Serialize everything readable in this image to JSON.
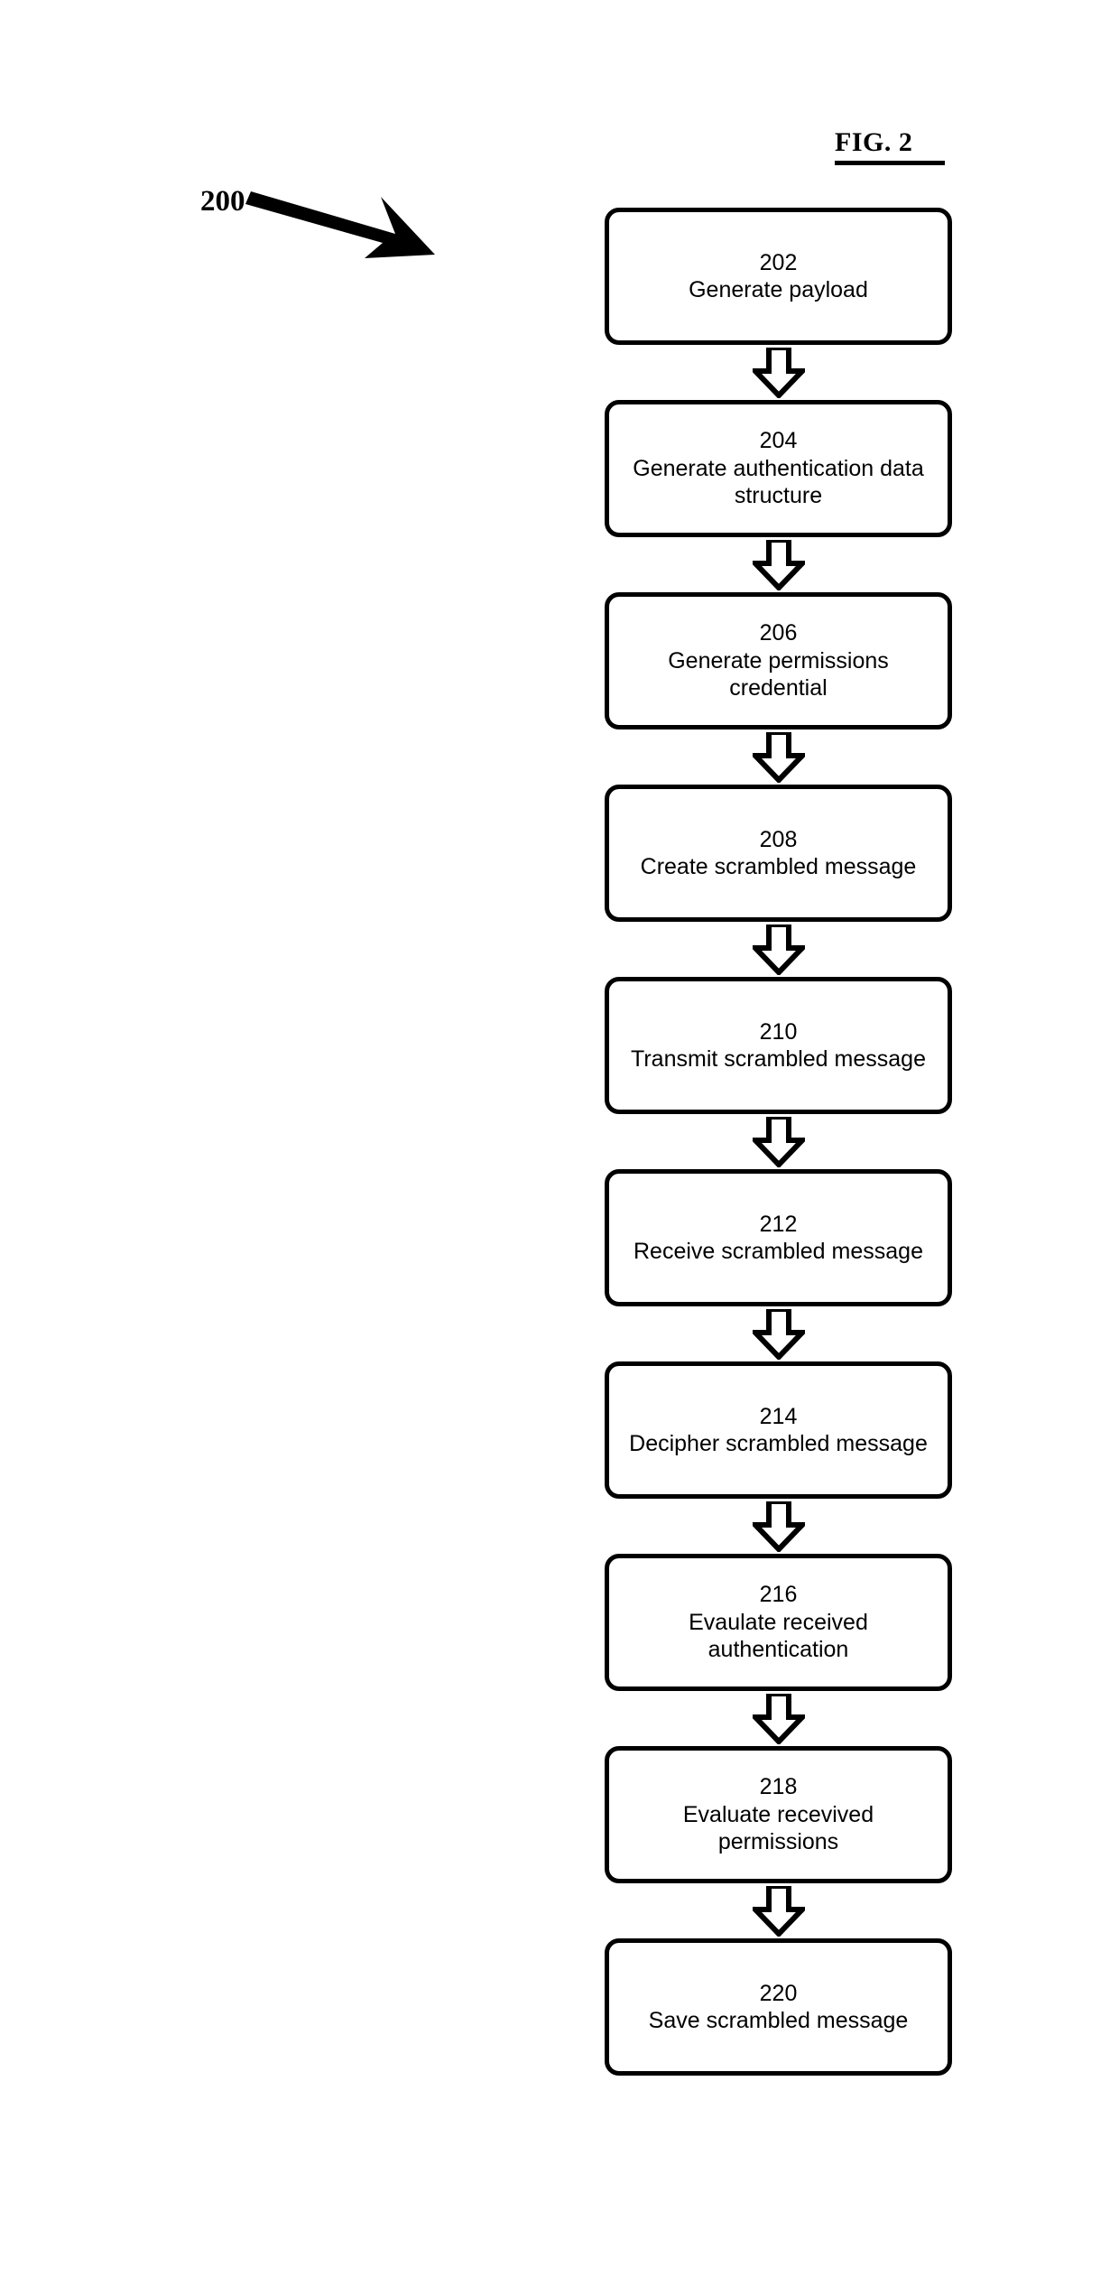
{
  "figure": {
    "title": "FIG. 2",
    "reference_numeral": "200"
  },
  "flow": {
    "nodes": [
      {
        "number": "202",
        "label": "Generate payload"
      },
      {
        "number": "204",
        "label": "Generate authentication data structure"
      },
      {
        "number": "206",
        "label": "Generate permissions credential"
      },
      {
        "number": "208",
        "label": "Create scrambled message"
      },
      {
        "number": "210",
        "label": "Transmit scrambled message"
      },
      {
        "number": "212",
        "label": "Receive scrambled message"
      },
      {
        "number": "214",
        "label": "Decipher scrambled message"
      },
      {
        "number": "216",
        "label": "Evaulate received authentication"
      },
      {
        "number": "218",
        "label": "Evaluate recevived permissions"
      },
      {
        "number": "220",
        "label": "Save scrambled message"
      }
    ],
    "connector_icon": "down-block-arrow-icon",
    "lead_arrow_icon": "lead-line-arrow-icon"
  },
  "style": {
    "stroke": "#000000",
    "background": "#ffffff"
  }
}
